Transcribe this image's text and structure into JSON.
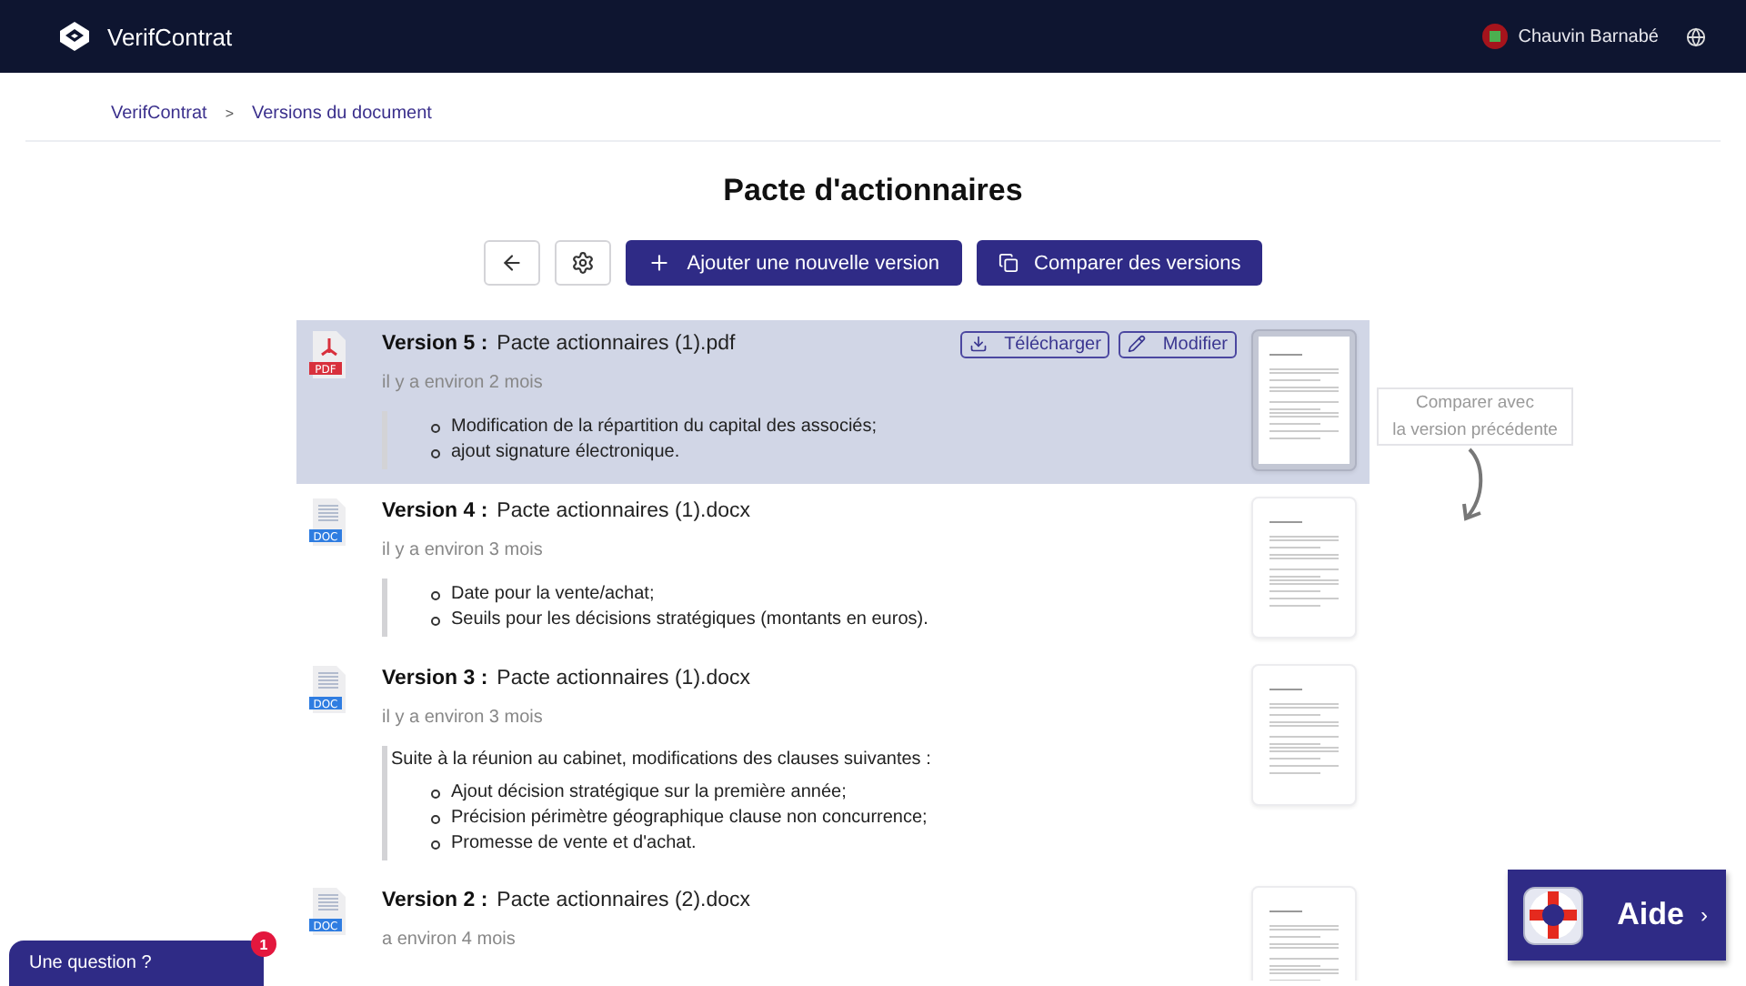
{
  "header": {
    "brand": "VerifContrat",
    "user": "Chauvin Barnabé"
  },
  "breadcrumb": [
    "VerifContrat",
    "Versions du document"
  ],
  "breadcrumb_separator": ">",
  "title": "Pacte d'actionnaires",
  "toolbar": {
    "add": "Ajouter une nouvelle version",
    "compare": "Comparer des versions"
  },
  "versions": [
    {
      "kind": "pdf",
      "tag": "PDF",
      "selected": true,
      "label": "Version 5 :",
      "file": "Pacte actionnaires (1).pdf",
      "time": "il y a environ 2 mois",
      "actions": [
        "Télécharger",
        "Modifier"
      ],
      "items": [
        "Modification de la répartition du capital des associés;",
        "ajout signature électronique."
      ]
    },
    {
      "kind": "doc",
      "tag": "DOC",
      "selected": false,
      "label": "Version 4 :",
      "file": "Pacte actionnaires (1).docx",
      "time": "il y a environ 3 mois",
      "items": [
        "Date pour la vente/achat;",
        "Seuils pour les décisions stratégiques (montants en euros)."
      ]
    },
    {
      "kind": "doc",
      "tag": "DOC",
      "selected": false,
      "label": "Version 3 :",
      "file": "Pacte actionnaires (1).docx",
      "time": "il y a environ 3 mois",
      "intro": "Suite à la réunion au cabinet, modifications des clauses suivantes :",
      "items": [
        "Ajout décision stratégique sur la première année;",
        "Précision périmètre géographique clause non concurrence;",
        "Promesse de vente et d'achat."
      ]
    },
    {
      "kind": "doc",
      "tag": "DOC",
      "selected": false,
      "label": "Version 2 :",
      "file": "Pacte actionnaires (2).docx",
      "time": "a environ 4 mois"
    }
  ],
  "compare_hint": [
    "Comparer avec",
    "la version précédente"
  ],
  "chat": {
    "label": "Une question ?",
    "badge": "1"
  },
  "help": {
    "label": "Aide",
    "chevron": "›"
  }
}
